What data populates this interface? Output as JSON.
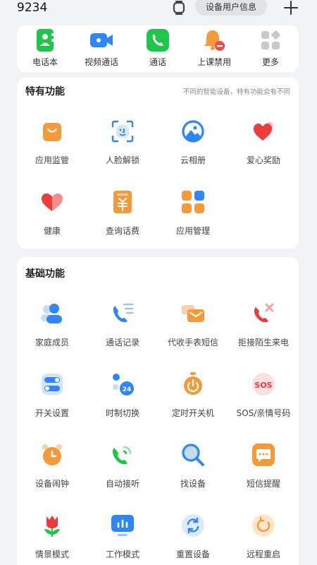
{
  "header": {
    "device_name": "9234",
    "device_info_label": "设备用户信息"
  },
  "quick_actions": [
    {
      "label": "电话本",
      "icon": "contacts-book-icon"
    },
    {
      "label": "视频通话",
      "icon": "video-call-icon"
    },
    {
      "label": "通话",
      "icon": "phone-call-icon"
    },
    {
      "label": "上课禁用",
      "icon": "class-mode-bell-icon"
    },
    {
      "label": "更多",
      "icon": "more-grid-icon"
    }
  ],
  "special": {
    "title": "特有功能",
    "note": "不同的智能设备，特有功能会有不同",
    "items": [
      {
        "label": "应用监管",
        "icon": "app-supervision-bag-icon"
      },
      {
        "label": "人脸解锁",
        "icon": "face-unlock-icon"
      },
      {
        "label": "云相册",
        "icon": "cloud-album-icon"
      },
      {
        "label": "爱心奖励",
        "icon": "heart-reward-icon"
      },
      {
        "label": "健康",
        "icon": "health-heart-icon"
      },
      {
        "label": "查询话费",
        "icon": "phone-bill-icon"
      },
      {
        "label": "应用管理",
        "icon": "app-management-icon"
      }
    ]
  },
  "basic": {
    "title": "基础功能",
    "items": [
      {
        "label": "家庭成员",
        "icon": "family-members-icon"
      },
      {
        "label": "通话记录",
        "icon": "call-log-icon"
      },
      {
        "label": "代收手表短信",
        "icon": "watch-sms-icon"
      },
      {
        "label": "拒接陌生来电",
        "icon": "reject-stranger-call-icon"
      },
      {
        "label": "开关设置",
        "icon": "switch-settings-icon"
      },
      {
        "label": "时制切换",
        "icon": "time-format-icon"
      },
      {
        "label": "定时开关机",
        "icon": "timed-power-icon"
      },
      {
        "label": "SOS/亲情号码",
        "icon": "sos-icon"
      },
      {
        "label": "设备闹钟",
        "icon": "alarm-clock-icon"
      },
      {
        "label": "自动接听",
        "icon": "auto-answer-icon"
      },
      {
        "label": "找设备",
        "icon": "find-device-icon"
      },
      {
        "label": "短信提醒",
        "icon": "sms-reminder-icon"
      },
      {
        "label": "情景模式",
        "icon": "scene-mode-icon"
      },
      {
        "label": "工作模式",
        "icon": "work-mode-icon"
      },
      {
        "label": "重置设备",
        "icon": "reset-device-icon"
      },
      {
        "label": "远程重启",
        "icon": "remote-restart-icon"
      }
    ]
  },
  "badges": {
    "time_format": "24",
    "sos": "SOS"
  },
  "colors": {
    "green": "#1fc44a",
    "blue": "#2f86f6",
    "orange": "#f59a3a",
    "red": "#ee4a4a",
    "background": "#f2f3f5"
  }
}
